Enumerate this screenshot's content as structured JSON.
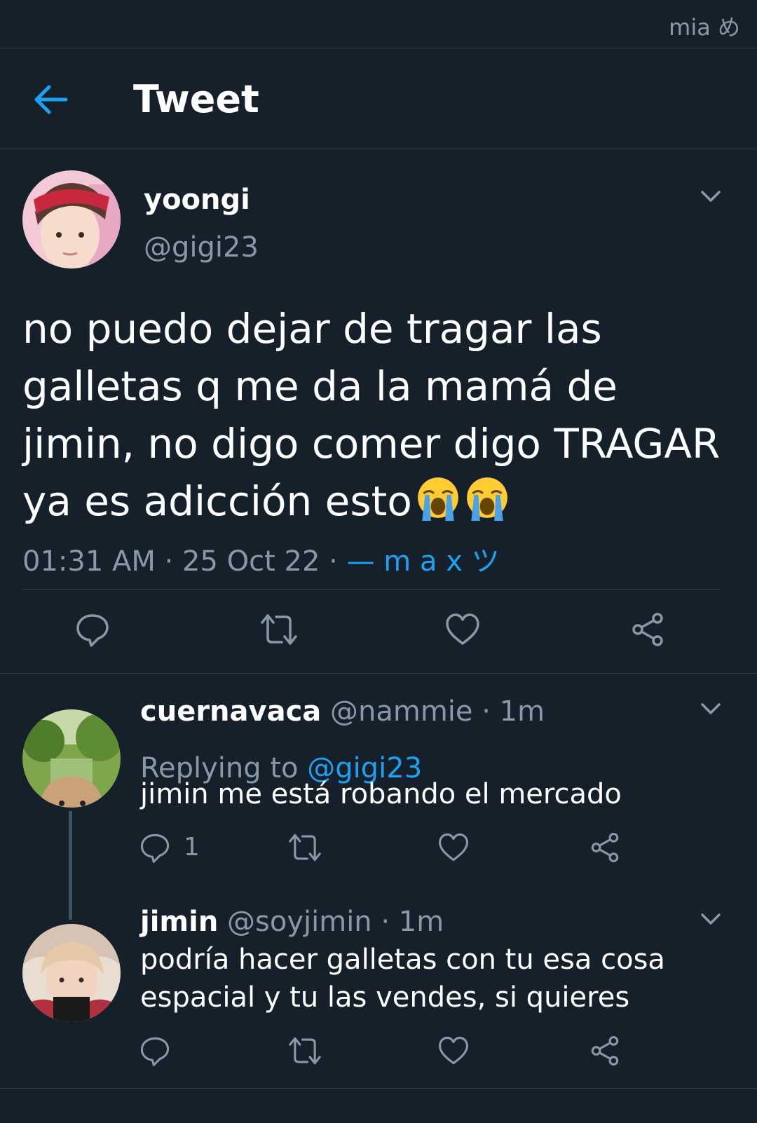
{
  "watermark": "mia め",
  "header": {
    "title": "Tweet"
  },
  "tweet": {
    "name": "yoongi",
    "handle": "@gigi23",
    "text": "no puedo dejar de tragar las galletas q me da la mamá de jimin, no digo comer digo TRAGAR ya es adicción esto",
    "emoji": "😭😭",
    "time": "01:31 AM",
    "date": "25 Oct 22",
    "source": "— m a x ツ",
    "separator": " · "
  },
  "replies": [
    {
      "name": "cuernavaca",
      "handle": "@nammie",
      "age": "· 1m",
      "replying_label": "Replying to",
      "replying_to": "@gigi23",
      "text": "jimin me está robando el mercado",
      "reply_count": "1"
    },
    {
      "name": "jimin",
      "handle": "@soyjimin",
      "age": "· 1m",
      "text_line1": "podría hacer galletas con tu esa cosa",
      "text_line2": "espacial y tu las vendes, si quieres"
    }
  ],
  "colors": {
    "background": "#15202b",
    "accent": "#1da1f2",
    "muted": "#8899a6",
    "divider": "#38444d"
  },
  "icons": [
    "back-arrow-icon",
    "chevron-down-icon",
    "reply-icon",
    "retweet-icon",
    "like-icon",
    "share-icon",
    "loudly-crying-face-emoji"
  ]
}
